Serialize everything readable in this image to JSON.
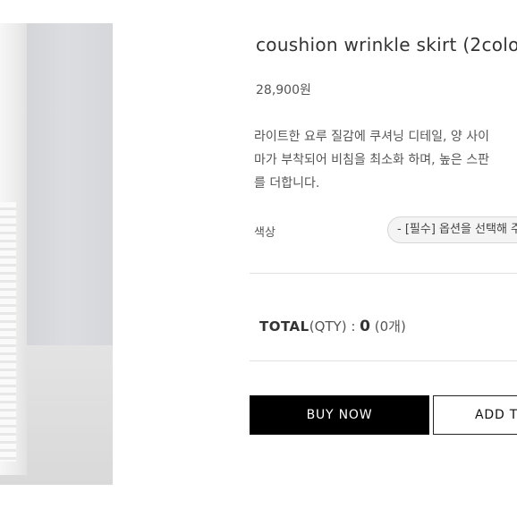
{
  "product": {
    "title": "coushion wrinkle skirt (2colo",
    "price": "28,900원",
    "description": [
      "라이트한 요루 질감에 쿠셔닝 디테일, 양 사이",
      "마가 부착되어 비침을 최소화 하며, 높은 스판",
      "를 더합니다."
    ]
  },
  "option": {
    "label": "색상",
    "selected": "- [필수] 옵션을 선택해 주"
  },
  "total": {
    "label": "TOTAL",
    "qty_label": "(QTY) : ",
    "amount": "0",
    "count": " (0개)"
  },
  "actions": {
    "buy_now": "BUY NOW",
    "add_to_cart": "ADD T"
  }
}
